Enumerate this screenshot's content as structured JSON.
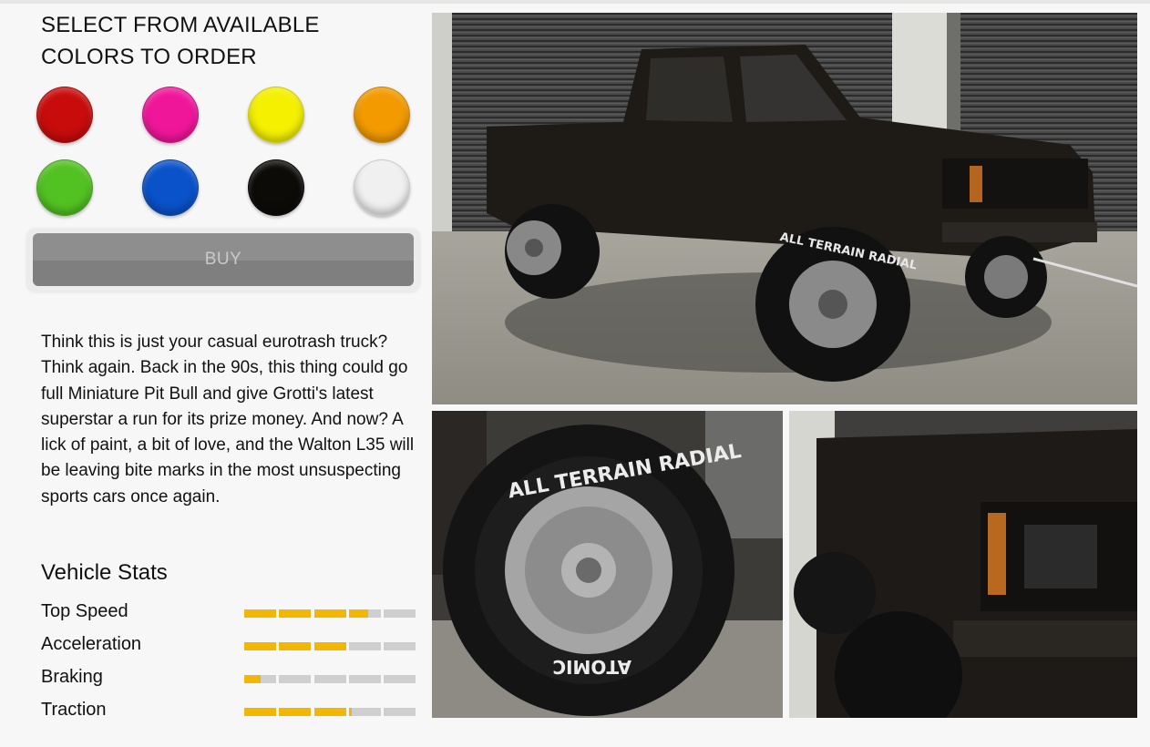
{
  "heading": "SELECT FROM AVAILABLE COLORS TO ORDER",
  "colors": [
    {
      "name": "red",
      "hex": "#c80c0c"
    },
    {
      "name": "pink",
      "hex": "#f0169a"
    },
    {
      "name": "yellow",
      "hex": "#f4f000"
    },
    {
      "name": "orange",
      "hex": "#f29a00"
    },
    {
      "name": "green",
      "hex": "#52c122"
    },
    {
      "name": "blue",
      "hex": "#0a52c9"
    },
    {
      "name": "black",
      "hex": "#0c0b08"
    },
    {
      "name": "white",
      "hex": "#f0f0f0"
    }
  ],
  "buy_label": "BUY",
  "description": "Think this is just your casual eurotrash truck? Think again. Back in the 90s, this thing could go full Miniature Pit Bull and give Grotti's latest superstar a run for its prize money. And now? A lick of paint, a bit of love, and the Walton L35 will be leaving bite marks in the most unsuspecting sports cars once again.",
  "stats": {
    "title": "Vehicle Stats",
    "items": [
      {
        "label": "Top Speed",
        "value": 0.72
      },
      {
        "label": "Acceleration",
        "value": 0.6
      },
      {
        "label": "Braking",
        "value": 0.1
      },
      {
        "label": "Traction",
        "value": 0.62
      }
    ]
  },
  "tire_text": {
    "brand_line": "ALL TERRAIN RADIAL",
    "maker": "ATOMIC"
  },
  "accent_color": "#f2b705"
}
